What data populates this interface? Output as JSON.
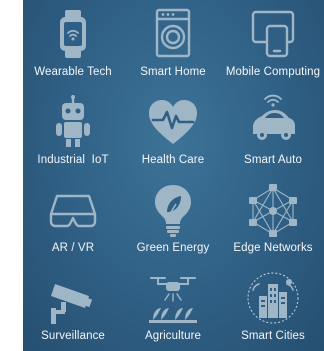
{
  "tiles": [
    {
      "label": "Wearable Tech",
      "icon": "smartwatch-icon"
    },
    {
      "label": "Smart Home",
      "icon": "washing-machine-icon"
    },
    {
      "label": "Mobile Computing",
      "icon": "phone-tablet-icon"
    },
    {
      "label": "Industrial  IoT",
      "icon": "robot-icon"
    },
    {
      "label": "Health Care",
      "icon": "heartbeat-icon"
    },
    {
      "label": "Smart Auto",
      "icon": "connected-car-icon"
    },
    {
      "label": "AR / VR",
      "icon": "smart-glasses-icon"
    },
    {
      "label": "Green Energy",
      "icon": "eco-lightbulb-icon"
    },
    {
      "label": "Edge Networks",
      "icon": "network-mesh-icon"
    },
    {
      "label": "Surveillance",
      "icon": "security-camera-icon"
    },
    {
      "label": "Agriculture",
      "icon": "drone-crops-icon"
    },
    {
      "label": "Smart Cities",
      "icon": "city-network-icon"
    }
  ],
  "colors": {
    "background": "#2f5f84",
    "icon": "#9fb6c7",
    "text": "#f2f6f9"
  }
}
